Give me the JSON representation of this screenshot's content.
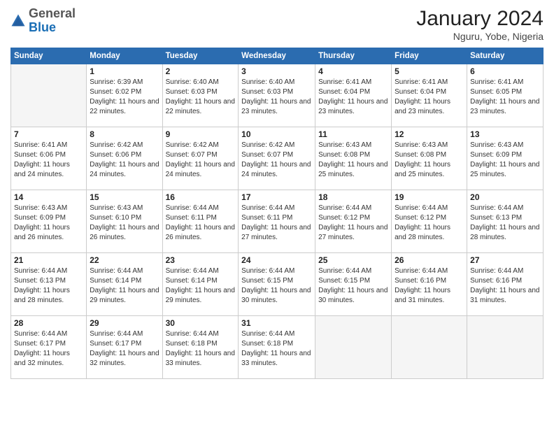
{
  "header": {
    "logo": {
      "general": "General",
      "blue": "Blue"
    },
    "title": "January 2024",
    "location": "Nguru, Yobe, Nigeria"
  },
  "calendar": {
    "days_of_week": [
      "Sunday",
      "Monday",
      "Tuesday",
      "Wednesday",
      "Thursday",
      "Friday",
      "Saturday"
    ],
    "weeks": [
      [
        {
          "day": "",
          "empty": true
        },
        {
          "day": "1",
          "sunrise": "Sunrise: 6:39 AM",
          "sunset": "Sunset: 6:02 PM",
          "daylight": "Daylight: 11 hours and 22 minutes."
        },
        {
          "day": "2",
          "sunrise": "Sunrise: 6:40 AM",
          "sunset": "Sunset: 6:03 PM",
          "daylight": "Daylight: 11 hours and 22 minutes."
        },
        {
          "day": "3",
          "sunrise": "Sunrise: 6:40 AM",
          "sunset": "Sunset: 6:03 PM",
          "daylight": "Daylight: 11 hours and 23 minutes."
        },
        {
          "day": "4",
          "sunrise": "Sunrise: 6:41 AM",
          "sunset": "Sunset: 6:04 PM",
          "daylight": "Daylight: 11 hours and 23 minutes."
        },
        {
          "day": "5",
          "sunrise": "Sunrise: 6:41 AM",
          "sunset": "Sunset: 6:04 PM",
          "daylight": "Daylight: 11 hours and 23 minutes."
        },
        {
          "day": "6",
          "sunrise": "Sunrise: 6:41 AM",
          "sunset": "Sunset: 6:05 PM",
          "daylight": "Daylight: 11 hours and 23 minutes."
        }
      ],
      [
        {
          "day": "7",
          "sunrise": "Sunrise: 6:41 AM",
          "sunset": "Sunset: 6:06 PM",
          "daylight": "Daylight: 11 hours and 24 minutes."
        },
        {
          "day": "8",
          "sunrise": "Sunrise: 6:42 AM",
          "sunset": "Sunset: 6:06 PM",
          "daylight": "Daylight: 11 hours and 24 minutes."
        },
        {
          "day": "9",
          "sunrise": "Sunrise: 6:42 AM",
          "sunset": "Sunset: 6:07 PM",
          "daylight": "Daylight: 11 hours and 24 minutes."
        },
        {
          "day": "10",
          "sunrise": "Sunrise: 6:42 AM",
          "sunset": "Sunset: 6:07 PM",
          "daylight": "Daylight: 11 hours and 24 minutes."
        },
        {
          "day": "11",
          "sunrise": "Sunrise: 6:43 AM",
          "sunset": "Sunset: 6:08 PM",
          "daylight": "Daylight: 11 hours and 25 minutes."
        },
        {
          "day": "12",
          "sunrise": "Sunrise: 6:43 AM",
          "sunset": "Sunset: 6:08 PM",
          "daylight": "Daylight: 11 hours and 25 minutes."
        },
        {
          "day": "13",
          "sunrise": "Sunrise: 6:43 AM",
          "sunset": "Sunset: 6:09 PM",
          "daylight": "Daylight: 11 hours and 25 minutes."
        }
      ],
      [
        {
          "day": "14",
          "sunrise": "Sunrise: 6:43 AM",
          "sunset": "Sunset: 6:09 PM",
          "daylight": "Daylight: 11 hours and 26 minutes."
        },
        {
          "day": "15",
          "sunrise": "Sunrise: 6:43 AM",
          "sunset": "Sunset: 6:10 PM",
          "daylight": "Daylight: 11 hours and 26 minutes."
        },
        {
          "day": "16",
          "sunrise": "Sunrise: 6:44 AM",
          "sunset": "Sunset: 6:11 PM",
          "daylight": "Daylight: 11 hours and 26 minutes."
        },
        {
          "day": "17",
          "sunrise": "Sunrise: 6:44 AM",
          "sunset": "Sunset: 6:11 PM",
          "daylight": "Daylight: 11 hours and 27 minutes."
        },
        {
          "day": "18",
          "sunrise": "Sunrise: 6:44 AM",
          "sunset": "Sunset: 6:12 PM",
          "daylight": "Daylight: 11 hours and 27 minutes."
        },
        {
          "day": "19",
          "sunrise": "Sunrise: 6:44 AM",
          "sunset": "Sunset: 6:12 PM",
          "daylight": "Daylight: 11 hours and 28 minutes."
        },
        {
          "day": "20",
          "sunrise": "Sunrise: 6:44 AM",
          "sunset": "Sunset: 6:13 PM",
          "daylight": "Daylight: 11 hours and 28 minutes."
        }
      ],
      [
        {
          "day": "21",
          "sunrise": "Sunrise: 6:44 AM",
          "sunset": "Sunset: 6:13 PM",
          "daylight": "Daylight: 11 hours and 28 minutes."
        },
        {
          "day": "22",
          "sunrise": "Sunrise: 6:44 AM",
          "sunset": "Sunset: 6:14 PM",
          "daylight": "Daylight: 11 hours and 29 minutes."
        },
        {
          "day": "23",
          "sunrise": "Sunrise: 6:44 AM",
          "sunset": "Sunset: 6:14 PM",
          "daylight": "Daylight: 11 hours and 29 minutes."
        },
        {
          "day": "24",
          "sunrise": "Sunrise: 6:44 AM",
          "sunset": "Sunset: 6:15 PM",
          "daylight": "Daylight: 11 hours and 30 minutes."
        },
        {
          "day": "25",
          "sunrise": "Sunrise: 6:44 AM",
          "sunset": "Sunset: 6:15 PM",
          "daylight": "Daylight: 11 hours and 30 minutes."
        },
        {
          "day": "26",
          "sunrise": "Sunrise: 6:44 AM",
          "sunset": "Sunset: 6:16 PM",
          "daylight": "Daylight: 11 hours and 31 minutes."
        },
        {
          "day": "27",
          "sunrise": "Sunrise: 6:44 AM",
          "sunset": "Sunset: 6:16 PM",
          "daylight": "Daylight: 11 hours and 31 minutes."
        }
      ],
      [
        {
          "day": "28",
          "sunrise": "Sunrise: 6:44 AM",
          "sunset": "Sunset: 6:17 PM",
          "daylight": "Daylight: 11 hours and 32 minutes."
        },
        {
          "day": "29",
          "sunrise": "Sunrise: 6:44 AM",
          "sunset": "Sunset: 6:17 PM",
          "daylight": "Daylight: 11 hours and 32 minutes."
        },
        {
          "day": "30",
          "sunrise": "Sunrise: 6:44 AM",
          "sunset": "Sunset: 6:18 PM",
          "daylight": "Daylight: 11 hours and 33 minutes."
        },
        {
          "day": "31",
          "sunrise": "Sunrise: 6:44 AM",
          "sunset": "Sunset: 6:18 PM",
          "daylight": "Daylight: 11 hours and 33 minutes."
        },
        {
          "day": "",
          "empty": true
        },
        {
          "day": "",
          "empty": true
        },
        {
          "day": "",
          "empty": true
        }
      ]
    ]
  }
}
